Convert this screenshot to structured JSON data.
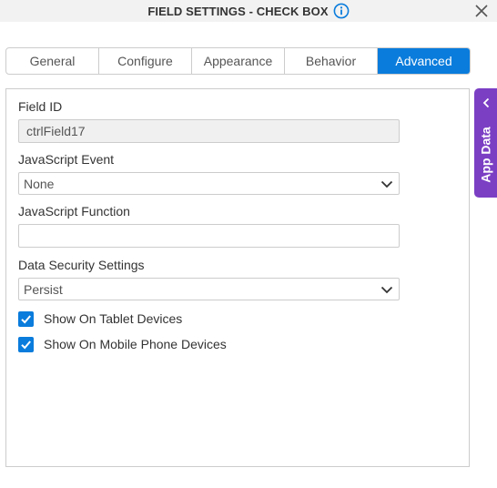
{
  "header": {
    "title": "FIELD SETTINGS - CHECK BOX",
    "info_icon": "info-circle-icon",
    "close_icon": "close-icon"
  },
  "tabs": [
    {
      "label": "General",
      "active": false
    },
    {
      "label": "Configure",
      "active": false
    },
    {
      "label": "Appearance",
      "active": false
    },
    {
      "label": "Behavior",
      "active": false
    },
    {
      "label": "Advanced",
      "active": true
    }
  ],
  "form": {
    "field_id": {
      "label": "Field ID",
      "value": "ctrlField17"
    },
    "javascript_event": {
      "label": "JavaScript Event",
      "value": "None"
    },
    "javascript_function": {
      "label": "JavaScript Function",
      "value": ""
    },
    "data_security": {
      "label": "Data Security Settings",
      "value": "Persist"
    },
    "show_on_tablet": {
      "label": "Show On Tablet Devices",
      "checked": true
    },
    "show_on_mobile": {
      "label": "Show On Mobile Phone Devices",
      "checked": true
    }
  },
  "side_panel": {
    "label": "App Data",
    "icon": "chevron-left-icon"
  },
  "colors": {
    "accent": "#0a7cdc",
    "side_panel": "#7b3fc4",
    "header_bg": "#f2f2f2"
  }
}
